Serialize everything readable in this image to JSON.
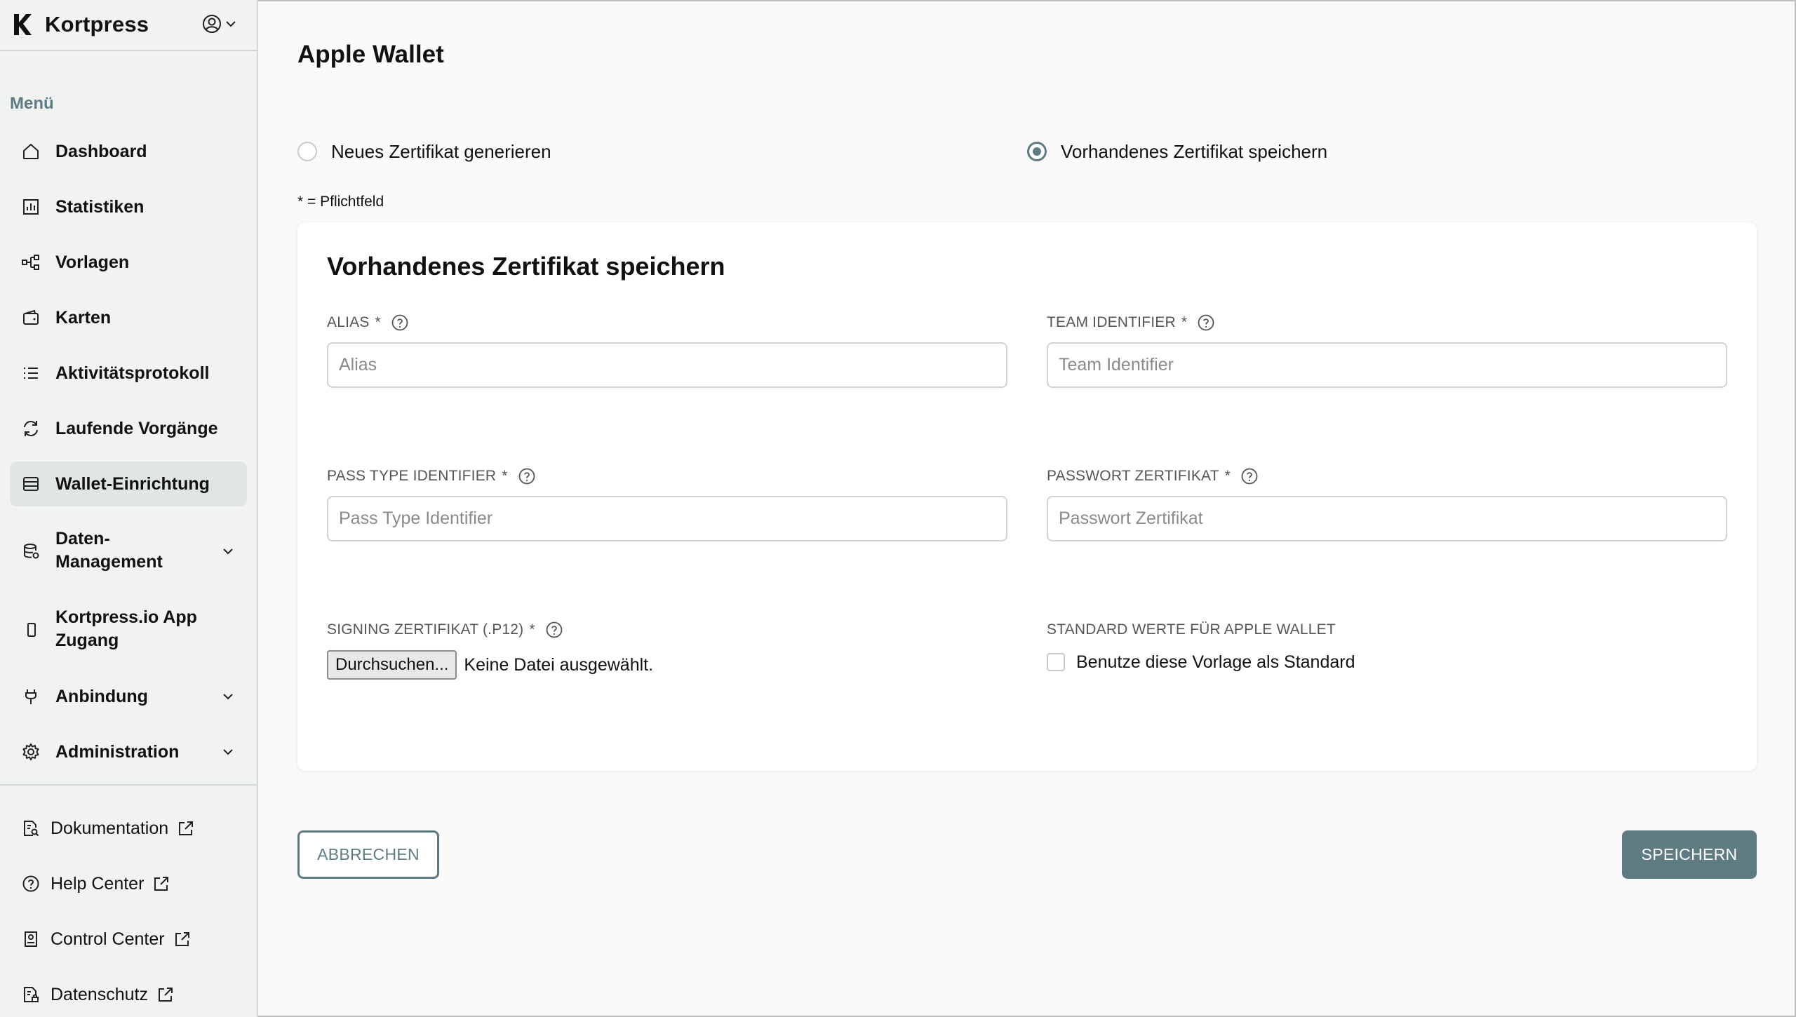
{
  "app": {
    "name": "Kortpress",
    "logo_icon": "kortpress-logo",
    "user_icon": "user-circle-icon"
  },
  "sidebar": {
    "menu_heading": "Menü",
    "items": [
      {
        "label": "Dashboard",
        "icon": "home-icon"
      },
      {
        "label": "Statistiken",
        "icon": "bar-chart-icon"
      },
      {
        "label": "Vorlagen",
        "icon": "templates-icon"
      },
      {
        "label": "Karten",
        "icon": "wallet-card-icon"
      },
      {
        "label": "Aktivitätsprotokoll",
        "icon": "list-icon"
      },
      {
        "label": "Laufende Vorgänge",
        "icon": "refresh-icon"
      },
      {
        "label": "Wallet-Einrichtung",
        "icon": "wallet-setup-icon",
        "active": true
      },
      {
        "label_line1": "Daten-",
        "label_line2": "Management",
        "icon": "database-icon",
        "expandable": true
      },
      {
        "label_line1": "Kortpress.io App",
        "label_line2": "Zugang",
        "icon": "smartphone-icon"
      },
      {
        "label": "Anbindung",
        "icon": "plug-icon",
        "expandable": true
      },
      {
        "label": "Administration",
        "icon": "gear-icon",
        "expandable": true
      }
    ],
    "external_links": [
      {
        "label": "Dokumentation",
        "icon": "document-search-icon"
      },
      {
        "label": "Help Center",
        "icon": "help-circle-icon"
      },
      {
        "label": "Control Center",
        "icon": "control-center-icon"
      },
      {
        "label": "Datenschutz",
        "icon": "privacy-document-icon"
      }
    ]
  },
  "main": {
    "title": "Apple Wallet",
    "radio_options": [
      {
        "label": "Neues Zertifikat generieren",
        "checked": false
      },
      {
        "label": "Vorhandenes Zertifikat speichern",
        "checked": true
      }
    ],
    "required_note": "* = Pflichtfeld",
    "form": {
      "title": "Vorhandenes Zertifikat speichern",
      "alias": {
        "label": "ALIAS",
        "required": "*",
        "placeholder": "Alias",
        "value": ""
      },
      "team_identifier": {
        "label": "TEAM IDENTIFIER",
        "required": "*",
        "placeholder": "Team Identifier",
        "value": ""
      },
      "pass_type_identifier": {
        "label": "PASS TYPE IDENTIFIER",
        "required": "*",
        "placeholder": "Pass Type Identifier",
        "value": ""
      },
      "passwort_zertifikat": {
        "label": "PASSWORT ZERTIFIKAT",
        "required": "*",
        "placeholder": "Passwort Zertifikat",
        "value": ""
      },
      "signing_zertifikat": {
        "label": "SIGNING ZERTIFIKAT (.P12)",
        "required": "*",
        "browse_label": "Durchsuchen...",
        "status": "Keine Datei ausgewählt."
      },
      "standard_werte": {
        "label": "STANDARD WERTE FÜR APPLE WALLET",
        "checkbox_label": "Benutze diese Vorlage als Standard",
        "checked": false
      }
    },
    "buttons": {
      "cancel": "ABBRECHEN",
      "save": "SPEICHERN"
    }
  },
  "colors": {
    "accent": "#5f7b82",
    "sidebar_bg": "#f1f3f3",
    "active_item_bg": "#e1e5e5"
  }
}
